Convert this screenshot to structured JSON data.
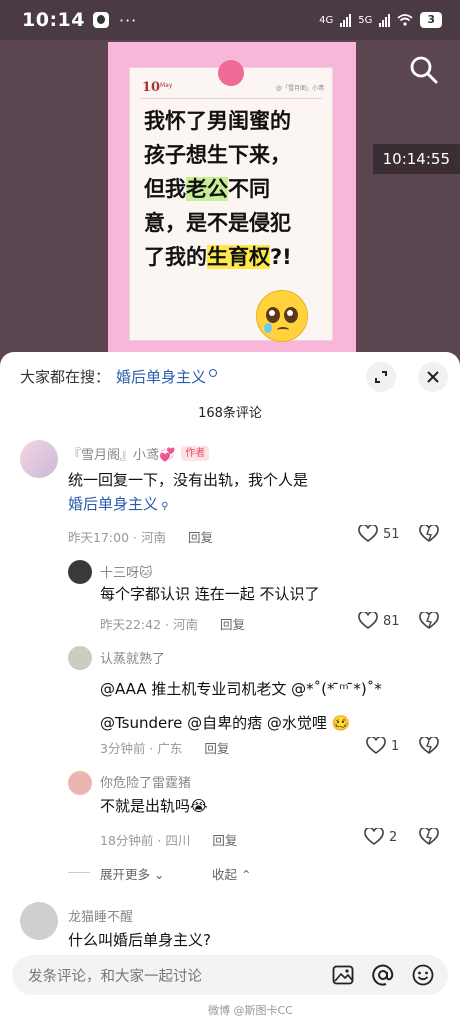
{
  "status_bar": {
    "time": "10:14",
    "network_1": "4G",
    "network_2": "5G",
    "battery": "3"
  },
  "video": {
    "timestamp": "10:14:55",
    "card": {
      "day": "10",
      "month": "May",
      "tag": "@「雪月阁」小鸢",
      "lines": [
        [
          {
            "t": "我怀了男闺蜜的",
            "h": ""
          }
        ],
        [
          {
            "t": "孩子想生下来，",
            "h": ""
          }
        ],
        [
          {
            "t": "但我",
            "h": ""
          },
          {
            "t": "老公",
            "h": "green"
          },
          {
            "t": "不同",
            "h": ""
          }
        ],
        [
          {
            "t": "意，是不是侵犯",
            "h": ""
          }
        ],
        [
          {
            "t": "了我的",
            "h": ""
          },
          {
            "t": "生育权",
            "h": "yellow"
          },
          {
            "t": "?!",
            "h": ""
          }
        ]
      ]
    }
  },
  "sheet": {
    "suggest_label": "大家都在搜：",
    "suggest_keyword": "婚后单身主义",
    "comment_count": "168条评论",
    "input_placeholder": "发条评论，和大家一起讨论"
  },
  "comments": [
    {
      "name": "『雪月阁』小鸢💞",
      "badge": "作者",
      "line1": "统一回复一下，没有出轨，我个人是",
      "line2": "婚后单身主义",
      "meta": "昨天17:00 · 河南",
      "reply": "回复",
      "likes": "51"
    },
    {
      "name": "十三呀🐱",
      "line1": "每个字都认识 连在一起 不认识了",
      "meta": "昨天22:42 · 河南",
      "reply": "回复",
      "likes": "81"
    },
    {
      "name": "认蒸就熟了",
      "line1": "@AAA 推土机专业司机老文 @*˚(* ̄ᵐ ̄*)˚*",
      "line2": "@Tsundere @自卑的痞 @水觉哩 🥴",
      "meta": "3分钟前 · 广东",
      "reply": "回复",
      "likes": "1"
    },
    {
      "name": "你危险了雷霆猪",
      "line1": "不就是出轨吗😭",
      "meta": "18分钟前 · 四川",
      "reply": "回复",
      "likes": "2"
    },
    {
      "name": "龙猫睡不醒",
      "line1": "什么叫婚后单身主义?"
    }
  ],
  "thread_controls": {
    "expand": "展开更多",
    "collapse": "收起"
  },
  "watermark": "微博 @斯图卡CC"
}
